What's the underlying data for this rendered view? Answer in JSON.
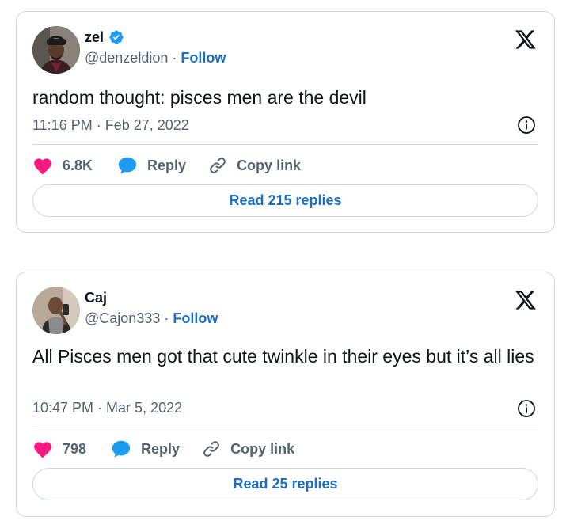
{
  "tweets": [
    {
      "author_name": "zel",
      "verified": true,
      "handle": "@denzeldion",
      "separator": " · ",
      "follow_label": "Follow",
      "text": "random thought: pisces men are the devil",
      "timestamp": "11:16 PM · Feb 27, 2022",
      "likes": "6.8K",
      "reply_label": "Reply",
      "copy_label": "Copy link",
      "read_replies_label": "Read 215 replies"
    },
    {
      "author_name": "Caj",
      "verified": false,
      "handle": "@Cajon333",
      "separator": " · ",
      "follow_label": "Follow",
      "text": "All Pisces men got that cute twinkle in their eyes but it’s all lies",
      "timestamp": "10:47 PM · Mar 5, 2022",
      "likes": "798",
      "reply_label": "Reply",
      "copy_label": "Copy link",
      "read_replies_label": "Read 25 replies"
    }
  ],
  "icons": {
    "brand": "x-logo-icon",
    "verified": "verified-badge-icon",
    "info": "info-icon",
    "like": "heart-icon",
    "reply": "speech-bubble-icon",
    "copy": "link-icon"
  },
  "colors": {
    "link_blue": "#1d6fc4",
    "heart_pink": "#f91880",
    "reply_blue": "#1d9bf0",
    "muted_text": "#536471",
    "border": "#cfd9de"
  }
}
